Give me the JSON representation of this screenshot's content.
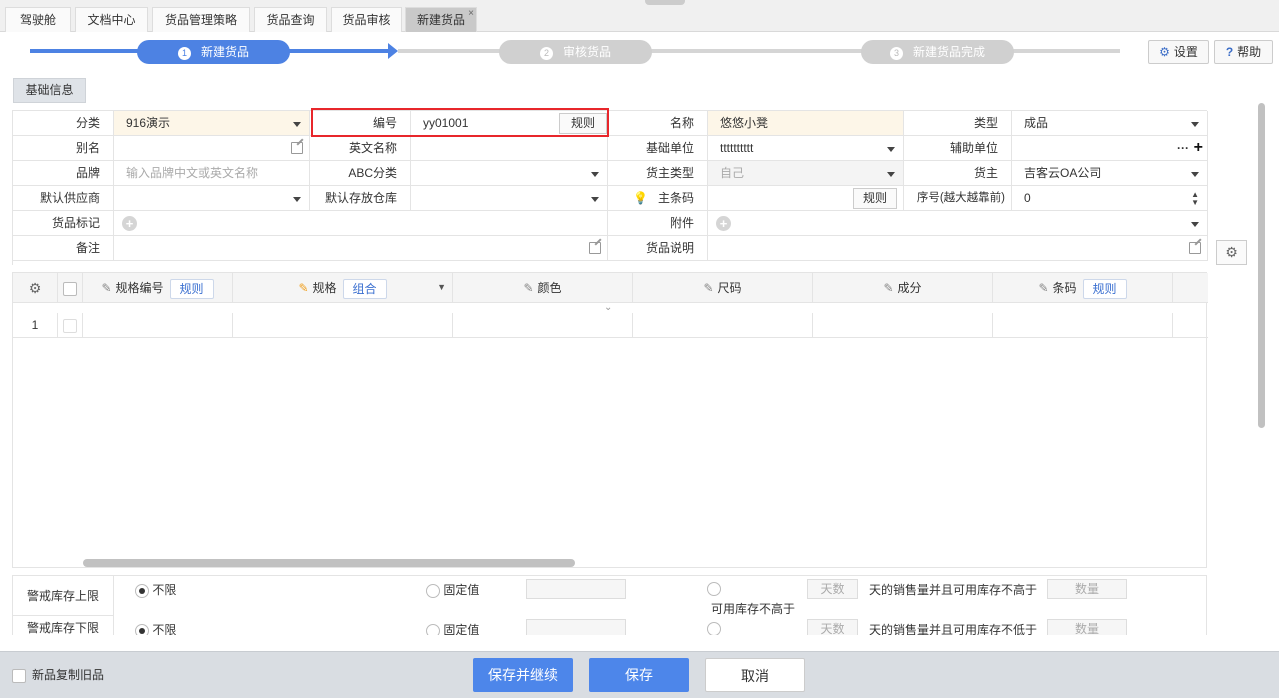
{
  "tabs": [
    {
      "label": "驾驶舱"
    },
    {
      "label": "文档中心"
    },
    {
      "label": "货品管理策略"
    },
    {
      "label": "货品查询"
    },
    {
      "label": "货品审核"
    },
    {
      "label": "新建货品",
      "close": "×"
    }
  ],
  "steps": [
    {
      "num": "1",
      "label": "新建货品",
      "state": "active"
    },
    {
      "num": "2",
      "label": "审核货品",
      "state": "inactive"
    },
    {
      "num": "3",
      "label": "新建货品完成",
      "state": "inactive"
    }
  ],
  "toolbar": {
    "settings": "设置",
    "settings_icon": "⚙",
    "help": "帮助",
    "help_icon": "?"
  },
  "section": {
    "basic_info": "基础信息"
  },
  "form": {
    "category": {
      "label": "分类",
      "value": "916演示"
    },
    "code": {
      "label": "编号",
      "value": "yy01001",
      "rule": "规则"
    },
    "name": {
      "label": "名称",
      "value": "悠悠小凳"
    },
    "type": {
      "label": "类型",
      "value": "成品"
    },
    "alias": {
      "label": "别名",
      "value": ""
    },
    "english_name": {
      "label": "英文名称",
      "value": ""
    },
    "base_unit": {
      "label": "基础单位",
      "value": "tttttttttt"
    },
    "aux_unit": {
      "label": "辅助单位",
      "more": "···",
      "add": "+"
    },
    "brand": {
      "label": "品牌",
      "placeholder": "输入品牌中文或英文名称"
    },
    "abc": {
      "label": "ABC分类",
      "value": ""
    },
    "owner_type": {
      "label": "货主类型",
      "value": "自己"
    },
    "owner": {
      "label": "货主",
      "value": "吉客云OA公司"
    },
    "supplier": {
      "label": "默认供应商",
      "value": ""
    },
    "warehouse": {
      "label": "默认存放仓库",
      "value": ""
    },
    "barcode": {
      "label": "主条码",
      "value": "",
      "rule": "规则",
      "bulb": "💡"
    },
    "sort": {
      "label": "序号(越大越靠前)",
      "value": "0"
    },
    "mark": {
      "label": "货品标记"
    },
    "attachment": {
      "label": "附件"
    },
    "remark": {
      "label": "备注",
      "value": ""
    },
    "description": {
      "label": "货品说明",
      "value": ""
    }
  },
  "grid": {
    "gear": "⚙",
    "columns": [
      {
        "label": "规格编号",
        "button": "规则"
      },
      {
        "label": "规格",
        "button": "组合"
      },
      {
        "label": "颜色"
      },
      {
        "label": "尺码"
      },
      {
        "label": "成分"
      },
      {
        "label": "条码",
        "button": "规则"
      }
    ],
    "rows": [
      {
        "index": "1"
      }
    ]
  },
  "limits": {
    "upper": {
      "label": "警戒库存上限",
      "unlimited": "不限",
      "fixed": "固定值",
      "days_placeholder": "天数",
      "suffix": "天的销售量并且可用库存不高于",
      "qty_placeholder": "数量",
      "extra": "可用库存不高于"
    },
    "lower": {
      "label": "警戒库存下限",
      "unlimited": "不限",
      "fixed": "固定值",
      "days_placeholder": "天数",
      "suffix": "天的销售量并且可用库存不低于",
      "qty_placeholder": "数量"
    }
  },
  "footer": {
    "copy_old": "新品复制旧品",
    "save_continue": "保存并继续",
    "save": "保存",
    "cancel": "取消"
  },
  "colors": {
    "primary": "#4d86ea",
    "highlight": "#e8262b",
    "yellow_field": "#fdf6e8"
  }
}
